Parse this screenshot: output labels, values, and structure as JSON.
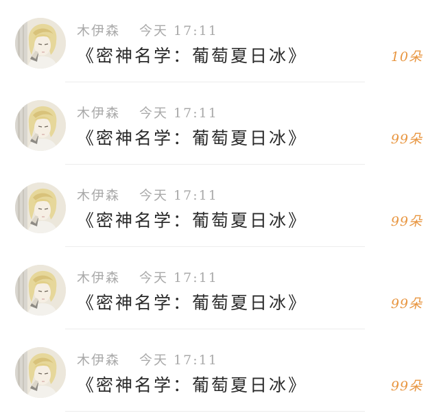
{
  "messages": [
    {
      "username": "木伊森",
      "time": "今天 17:11",
      "title": "《密神名学：葡萄夏日冰》",
      "gift": "10朵"
    },
    {
      "username": "木伊森",
      "time": "今天 17:11",
      "title": "《密神名学：葡萄夏日冰》",
      "gift": "99朵"
    },
    {
      "username": "木伊森",
      "time": "今天 17:11",
      "title": "《密神名学：葡萄夏日冰》",
      "gift": "99朵"
    },
    {
      "username": "木伊森",
      "time": "今天 17:11",
      "title": "《密神名学：葡萄夏日冰》",
      "gift": "99朵"
    },
    {
      "username": "木伊森",
      "time": "今天 17:11",
      "title": "《密神名学：葡萄夏日冰》",
      "gift": "99朵"
    }
  ],
  "colors": {
    "gift": "#e8953f",
    "meta": "#a9a9a9",
    "title": "#2a2a2a"
  }
}
